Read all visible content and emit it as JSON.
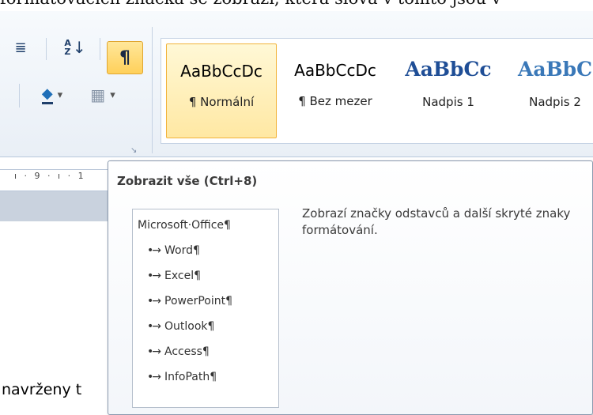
{
  "background_text": "formátovacích značka se zobrazí, která slova v tomto jsou v",
  "ribbon": {
    "buttons": {
      "indent_icon": "≣",
      "sort_icon": "↓",
      "sort_letters_top": "A",
      "sort_letters_bottom": "Z",
      "show_hide_symbol": "¶",
      "shading_icon": "◆",
      "border_icon": "▦",
      "dropdown_arrow": "▾",
      "launcher_icon": "↘"
    },
    "styles": [
      {
        "preview": "AaBbCcDc",
        "label": "¶ Normální",
        "selected": true
      },
      {
        "preview": "AaBbCcDc",
        "label": "¶ Bez mezer",
        "selected": false
      },
      {
        "preview": "AaBbCc",
        "label": "Nadpis 1",
        "selected": false
      },
      {
        "preview": "AaBbC",
        "label": "Nadpis 2",
        "selected": false
      }
    ]
  },
  "ruler": {
    "text": "ı · 9 · ı · 1"
  },
  "document": {
    "text": "navrženy t"
  },
  "tooltip": {
    "title": "Zobrazit vše (Ctrl+8)",
    "description": "Zobrazí značky odstavců a další skryté znaky formátování.",
    "preview": {
      "heading": "Microsoft·Office¶",
      "items": [
        "Word¶",
        "Excel¶",
        "PowerPoint¶",
        "Outlook¶",
        "Access¶",
        "InfoPath¶"
      ]
    }
  },
  "colors": {
    "accent_selected": "#ffd05a",
    "heading_blue": "#1f4e96",
    "ribbon_bg": "#e9eff6"
  }
}
